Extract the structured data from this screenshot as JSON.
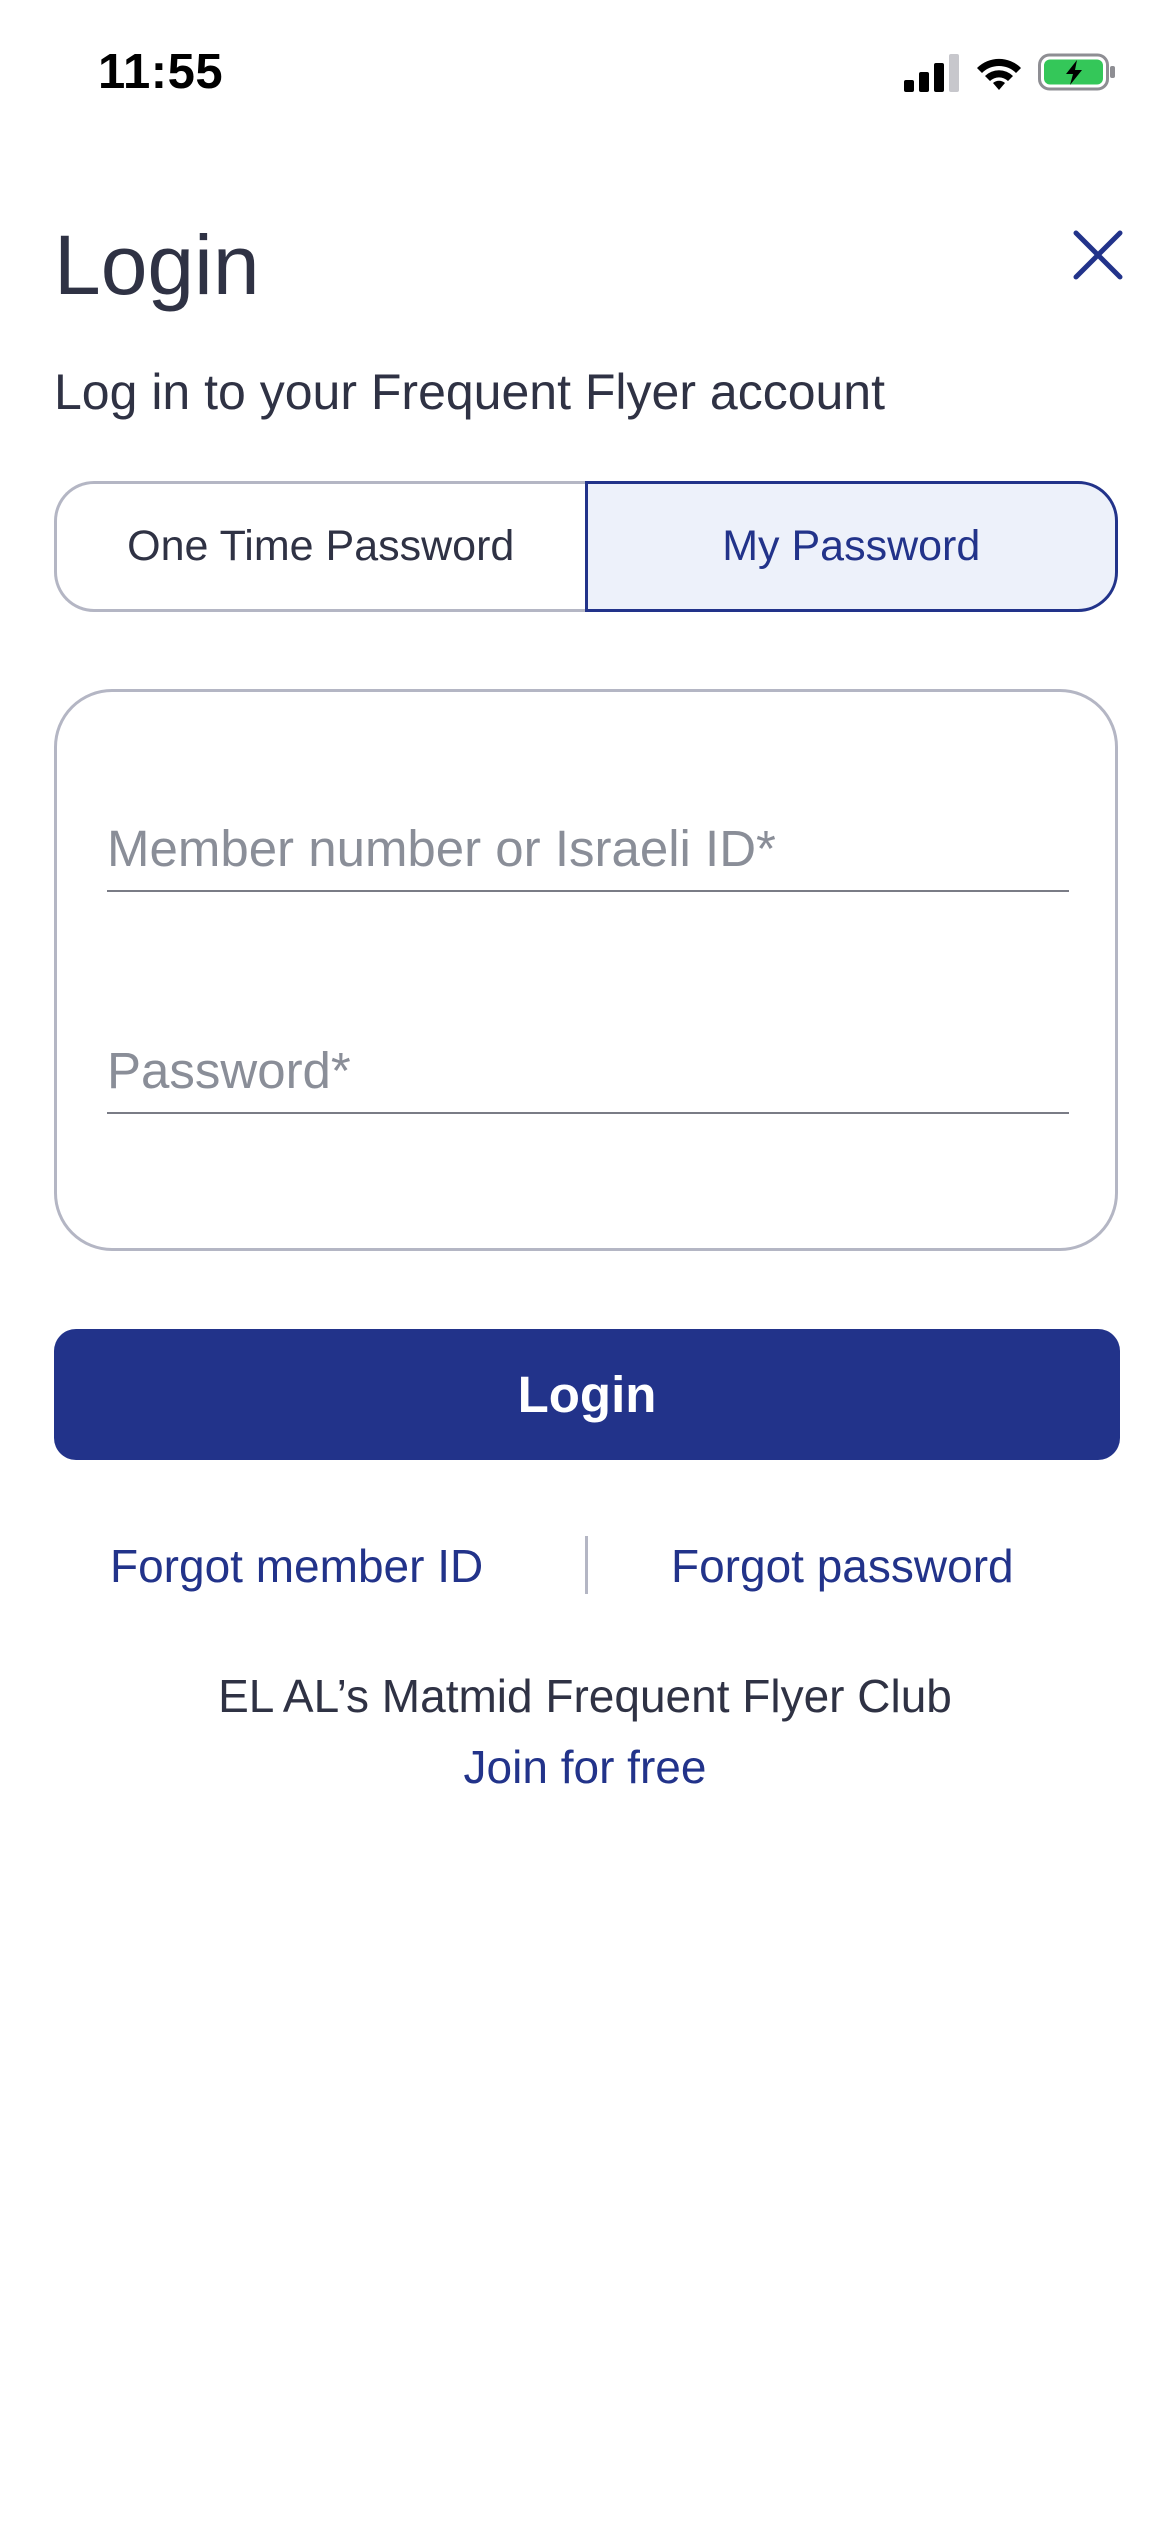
{
  "status_bar": {
    "time": "11:55",
    "icons": [
      "cellular-signal-icon",
      "wifi-icon",
      "battery-charging-icon"
    ]
  },
  "header": {
    "title": "Login",
    "subtitle": "Log in to your Frequent Flyer account",
    "close_icon": "close-icon"
  },
  "tabs": [
    {
      "label": "One Time Password",
      "selected": false
    },
    {
      "label": "My Password",
      "selected": true
    }
  ],
  "form": {
    "member_field": {
      "placeholder": "Member number or Israeli ID*",
      "value": ""
    },
    "password_field": {
      "placeholder": "Password*",
      "value": ""
    }
  },
  "actions": {
    "login_label": "Login",
    "forgot_member_id": "Forgot member ID",
    "forgot_password": "Forgot password"
  },
  "club": {
    "name": "EL AL’s Matmid Frequent Flyer Club",
    "join_label": "Join for free"
  },
  "colors": {
    "brand_blue": "#22338a",
    "text_dark": "#2f3244",
    "border_gray": "#b4b6c4",
    "selected_tab_bg": "#edf1fa",
    "battery_green": "#34c759"
  }
}
